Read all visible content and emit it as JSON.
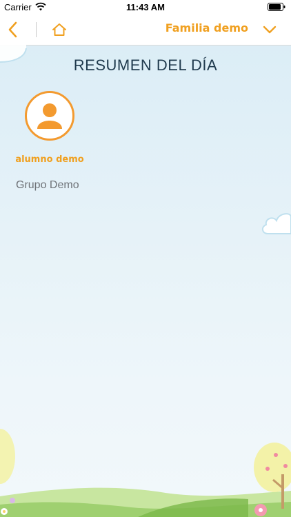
{
  "status_bar": {
    "carrier": "Carrier",
    "time": "11:43 AM"
  },
  "nav": {
    "family_name": "Familia demo",
    "accent_color": "#f0a020"
  },
  "page": {
    "title": "RESUMEN DEL DÍA"
  },
  "students": [
    {
      "name": "alumno demo",
      "group": "Grupo Demo",
      "avatar_icon": "person-icon",
      "avatar_color": "#f39a2f"
    }
  ]
}
